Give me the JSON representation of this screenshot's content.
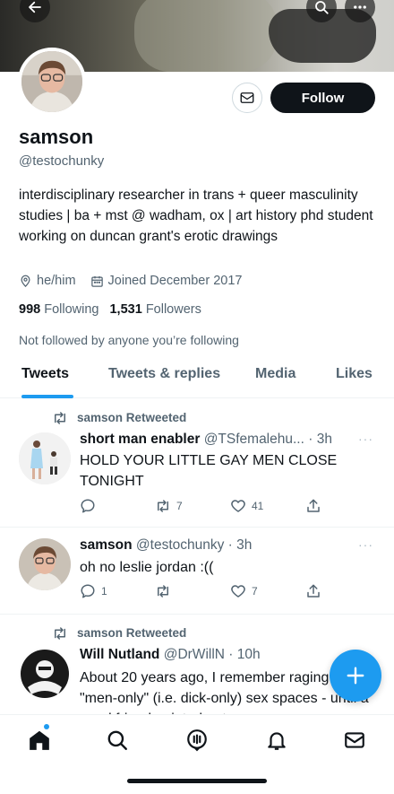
{
  "profile": {
    "name": "samson",
    "handle": "@testochunky",
    "bio": "interdisciplinary researcher in trans + queer masculinity studies | ba + mst @ wadham, ox | art history phd student working on duncan grant's erotic drawings",
    "pronouns": "he/him",
    "joined": "Joined December 2017",
    "following_count": "998",
    "following_label": "Following",
    "followers_count": "1,531",
    "followers_label": "Followers",
    "not_followed_text": "Not followed by anyone you’re following",
    "follow_label": "Follow"
  },
  "tabs": [
    "Tweets",
    "Tweets & replies",
    "Media",
    "Likes"
  ],
  "tweets": [
    {
      "retweet_label": "samson Retweeted",
      "display_name": "short man enabler",
      "handle": "@TSfemalehu...",
      "time": "· 3h",
      "text": "HOLD YOUR LITTLE GAY MEN CLOSE TONIGHT",
      "replies": "",
      "retweets": "7",
      "likes": "41"
    },
    {
      "display_name": "samson",
      "handle": "@testochunky",
      "time": "· 3h",
      "text": "oh no leslie jordan :((",
      "replies": "1",
      "retweets": "",
      "likes": "7"
    },
    {
      "retweet_label": "samson Retweeted",
      "display_name": "Will Nutland",
      "handle": "@DrWillN",
      "time": "· 10h",
      "text": "About 20 years ago, I remember raging about \"men-only\" (i.e. dick-only) sex spaces - until a good friend pointed out"
    }
  ],
  "more_glyph": "···",
  "colors": {
    "accent": "#1d9bf0",
    "text": "#0f1419",
    "muted": "#536471",
    "border": "#eff3f4"
  },
  "icons": [
    "back-arrow-icon",
    "search-icon",
    "more-icon",
    "mail-icon",
    "location-icon",
    "calendar-icon",
    "retweet-icon",
    "reply-icon",
    "like-icon",
    "share-icon",
    "compose-plus-icon",
    "home-icon",
    "explore-icon",
    "spaces-icon",
    "notifications-icon",
    "messages-icon"
  ]
}
